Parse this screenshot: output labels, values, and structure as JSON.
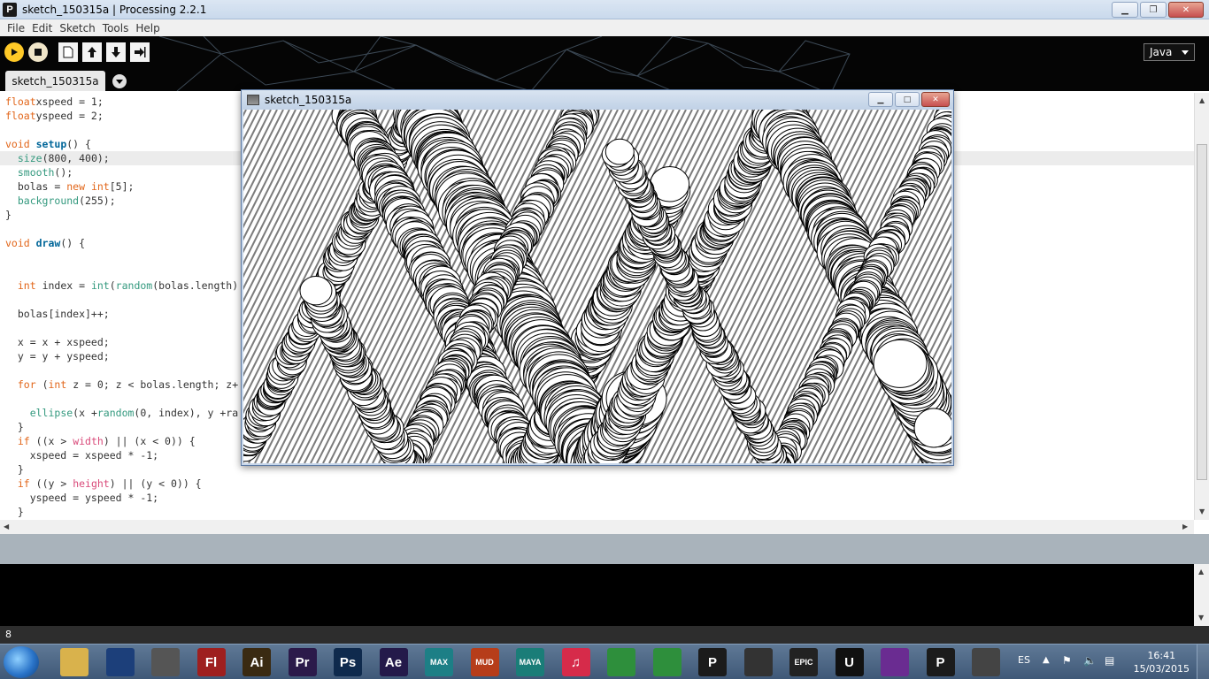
{
  "window": {
    "title": "sketch_150315a | Processing 2.2.1",
    "app_icon": "P"
  },
  "menu": [
    "File",
    "Edit",
    "Sketch",
    "Tools",
    "Help"
  ],
  "toolbar": {
    "mode": "Java"
  },
  "tab": {
    "label": "sketch_150315a"
  },
  "code": [
    [
      [
        "kw1",
        "float"
      ],
      [
        "",
        "xspeed = 1;"
      ]
    ],
    [
      [
        "kw1",
        "float"
      ],
      [
        "",
        "yspeed = 2;"
      ]
    ],
    [
      [
        "",
        ""
      ]
    ],
    [
      [
        "kw1",
        "void "
      ],
      [
        "kw2",
        "setup"
      ],
      [
        "",
        "() {"
      ]
    ],
    [
      [
        "",
        "  "
      ],
      [
        "kw3",
        "size"
      ],
      [
        "",
        "(800, 400);"
      ]
    ],
    [
      [
        "",
        "  "
      ],
      [
        "kw3",
        "smooth"
      ],
      [
        "",
        "();"
      ]
    ],
    [
      [
        "",
        "  bolas = "
      ],
      [
        "kw1",
        "new "
      ],
      [
        "kw1",
        "int"
      ],
      [
        "",
        "[5];"
      ]
    ],
    [
      [
        "",
        "  "
      ],
      [
        "kw3",
        "background"
      ],
      [
        "",
        "(255);"
      ]
    ],
    [
      [
        "",
        "}"
      ]
    ],
    [
      [
        "",
        ""
      ]
    ],
    [
      [
        "kw1",
        "void "
      ],
      [
        "kw2",
        "draw"
      ],
      [
        "",
        "() {"
      ]
    ],
    [
      [
        "",
        ""
      ]
    ],
    [
      [
        "",
        ""
      ]
    ],
    [
      [
        "",
        "  "
      ],
      [
        "kw1",
        "int"
      ],
      [
        "",
        " index = "
      ],
      [
        "kw3",
        "int"
      ],
      [
        "",
        "("
      ],
      [
        "kw3",
        "random"
      ],
      [
        "",
        "(bolas.length)"
      ]
    ],
    [
      [
        "",
        ""
      ]
    ],
    [
      [
        "",
        "  bolas[index]++;"
      ]
    ],
    [
      [
        "",
        ""
      ]
    ],
    [
      [
        "",
        "  x = x + xspeed;"
      ]
    ],
    [
      [
        "",
        "  y = y + yspeed;"
      ]
    ],
    [
      [
        "",
        ""
      ]
    ],
    [
      [
        "",
        "  "
      ],
      [
        "kw1",
        "for"
      ],
      [
        "",
        " ("
      ],
      [
        "kw1",
        "int"
      ],
      [
        "",
        " z = 0; z < bolas.length; z+"
      ]
    ],
    [
      [
        "",
        ""
      ]
    ],
    [
      [
        "",
        "    "
      ],
      [
        "kw3",
        "ellipse"
      ],
      [
        "",
        "(x +"
      ],
      [
        "kw3",
        "random"
      ],
      [
        "",
        "(0, index), y +ra"
      ]
    ],
    [
      [
        "",
        "  }"
      ]
    ],
    [
      [
        "",
        "  "
      ],
      [
        "kw1",
        "if"
      ],
      [
        "",
        " ((x > "
      ],
      [
        "kw4",
        "width"
      ],
      [
        "",
        ") || (x < 0)) {"
      ]
    ],
    [
      [
        "",
        "    xspeed = xspeed * -1;"
      ]
    ],
    [
      [
        "",
        "  }"
      ]
    ],
    [
      [
        "",
        "  "
      ],
      [
        "kw1",
        "if"
      ],
      [
        "",
        " ((y > "
      ],
      [
        "kw4",
        "height"
      ],
      [
        "",
        ") || (y < 0)) {"
      ]
    ],
    [
      [
        "",
        "    yspeed = yspeed * -1;"
      ]
    ],
    [
      [
        "",
        "  }"
      ]
    ]
  ],
  "status": {
    "line": "8"
  },
  "sketch_window": {
    "title": "sketch_150315a"
  },
  "taskbar": {
    "icons": [
      {
        "name": "file-explorer-icon",
        "label": "",
        "color": "#d9b24c"
      },
      {
        "name": "cinema4d-icon",
        "label": "",
        "color": "#1c3f7a"
      },
      {
        "name": "zbrush-icon",
        "label": "",
        "color": "#555555"
      },
      {
        "name": "flash-icon",
        "label": "Fl",
        "color": "#9e1f1f"
      },
      {
        "name": "illustrator-icon",
        "label": "Ai",
        "color": "#3a2a12"
      },
      {
        "name": "premiere-icon",
        "label": "Pr",
        "color": "#2b1a4a"
      },
      {
        "name": "photoshop-icon",
        "label": "Ps",
        "color": "#0f2a4d"
      },
      {
        "name": "after-effects-icon",
        "label": "Ae",
        "color": "#241a4a"
      },
      {
        "name": "3dsmax-icon",
        "label": "MAX",
        "color": "#1d7f86"
      },
      {
        "name": "mudbox-icon",
        "label": "MUD",
        "color": "#b63d1a"
      },
      {
        "name": "maya-icon",
        "label": "MAYA",
        "color": "#1a7d78"
      },
      {
        "name": "itunes-icon",
        "label": "♫",
        "color": "#d62b4a"
      },
      {
        "name": "chrome-icon",
        "label": "",
        "color": "#2e8f3c"
      },
      {
        "name": "chrome-active-icon",
        "label": "",
        "color": "#2e8f3c"
      },
      {
        "name": "processing-icon",
        "label": "P",
        "color": "#1b1b1b"
      },
      {
        "name": "unity-icon",
        "label": "",
        "color": "#333333"
      },
      {
        "name": "epic-games-icon",
        "label": "EPIC",
        "color": "#222222"
      },
      {
        "name": "unreal-icon",
        "label": "U",
        "color": "#111111"
      },
      {
        "name": "visual-studio-icon",
        "label": "",
        "color": "#6a2c91"
      },
      {
        "name": "processing-active-icon",
        "label": "P",
        "color": "#1b1b1b"
      },
      {
        "name": "sketch-window-icon",
        "label": "",
        "color": "#444444"
      }
    ],
    "lang": "ES",
    "time": "16:41",
    "date": "15/03/2015"
  }
}
